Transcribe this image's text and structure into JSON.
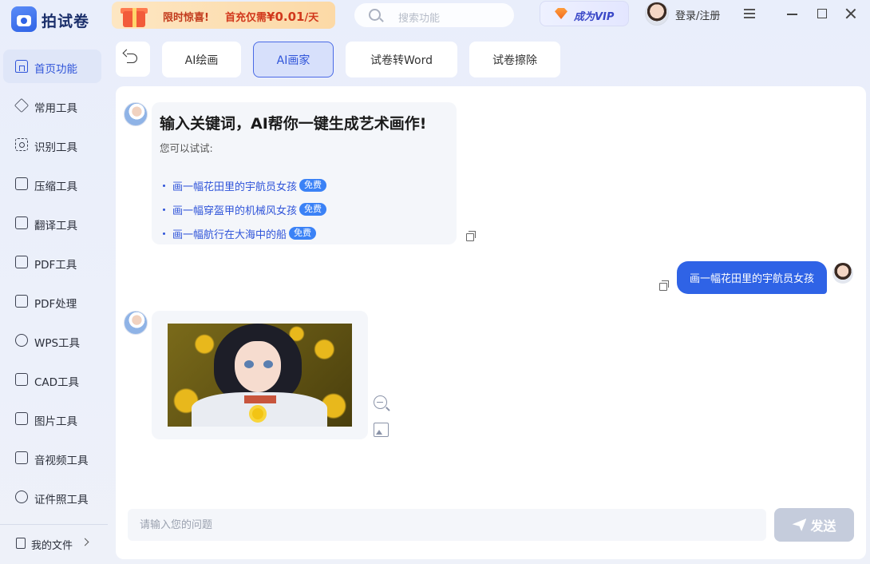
{
  "app": {
    "name": "拍试卷",
    "promo_label": "限时惊喜!",
    "promo_offer_prefix": "首充仅需",
    "promo_price": "¥0.01",
    "promo_offer_suffix": "/天",
    "search_placeholder": "搜索功能",
    "vip_label": "成为VIP",
    "login_label": "登录/注册"
  },
  "sidebar": {
    "items": [
      {
        "label": "首页功能",
        "icon": "home-icon",
        "active": true
      },
      {
        "label": "常用工具",
        "icon": "layers-icon"
      },
      {
        "label": "识别工具",
        "icon": "scan-icon"
      },
      {
        "label": "压缩工具",
        "icon": "compress-icon"
      },
      {
        "label": "翻译工具",
        "icon": "translate-icon"
      },
      {
        "label": "PDF工具",
        "icon": "pdf-icon"
      },
      {
        "label": "PDF处理",
        "icon": "pdf-process-icon"
      },
      {
        "label": "WPS工具",
        "icon": "wps-icon"
      },
      {
        "label": "CAD工具",
        "icon": "cad-icon"
      },
      {
        "label": "图片工具",
        "icon": "image-icon"
      },
      {
        "label": "音视频工具",
        "icon": "music-icon"
      },
      {
        "label": "证件照工具",
        "icon": "id-photo-icon"
      }
    ],
    "files_label": "我的文件"
  },
  "tabs": [
    {
      "label": "AI绘画"
    },
    {
      "label": "AI画家",
      "active": true
    },
    {
      "label": "试卷转Word"
    },
    {
      "label": "试卷擦除"
    }
  ],
  "chat": {
    "intro_title": "输入关键词，AI帮你一键生成艺术画作!",
    "intro_sub": "您可以试试:",
    "suggestions": [
      {
        "text": "画一幅花田里的宇航员女孩",
        "badge": "免费"
      },
      {
        "text": "画一幅穿盔甲的机械风女孩",
        "badge": "免费"
      },
      {
        "text": "画一幅航行在大海中的船",
        "badge": "免费"
      }
    ],
    "user_message": "画一幅花田里的宇航员女孩",
    "input_placeholder": "请输入您的问题",
    "send_label": "发送"
  },
  "colors": {
    "accent": "#2f63e6",
    "active_tab_bg": "#d7e0fb",
    "badge": "#3b82f6",
    "send_disabled": "#c5ccdc"
  }
}
